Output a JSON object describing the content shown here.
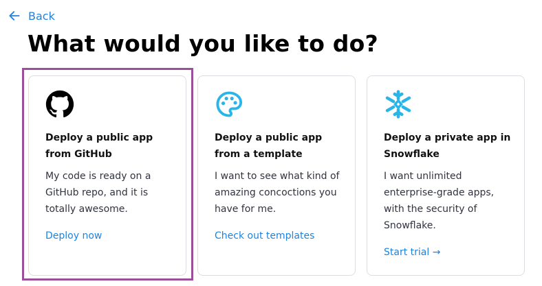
{
  "back": {
    "label": "Back"
  },
  "title": "What would you like to do?",
  "cards": [
    {
      "icon": "github-icon",
      "title": "Deploy a public app from GitHub",
      "description": "My code is ready on a GitHub repo, and it is totally awesome.",
      "link": "Deploy now"
    },
    {
      "icon": "palette-icon",
      "title": "Deploy a public app from a template",
      "description": "I want to see what kind of amazing concoctions you have for me.",
      "link": "Check out templates"
    },
    {
      "icon": "snowflake-icon",
      "title": "Deploy a private app in Snowflake",
      "description": "I want unlimited enterprise-grade apps, with the security of Snowflake.",
      "link": "Start trial →"
    }
  ],
  "colors": {
    "accent": "#1c83e1",
    "highlight": "#9b4f9b",
    "palette": "#29b5e8",
    "snowflake": "#29b5e8"
  }
}
